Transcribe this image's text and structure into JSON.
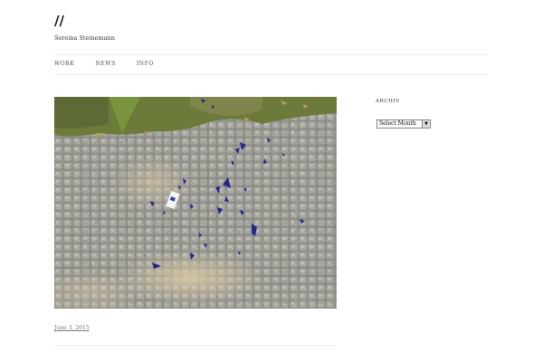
{
  "header": {
    "title": "//",
    "description": "Sereina Steinemann"
  },
  "nav": {
    "items": [
      {
        "label": "WORK"
      },
      {
        "label": "NEWS"
      },
      {
        "label": "INFO"
      }
    ]
  },
  "post": {
    "image_alt": "",
    "date": "June 3, 2015"
  },
  "sidebar": {
    "archive_title": "ARCHIV",
    "archive_select": "Select Month"
  },
  "colors": {
    "background": "#ffffff",
    "rule": "#ededed",
    "glass_blue": "#1f2a8c"
  }
}
